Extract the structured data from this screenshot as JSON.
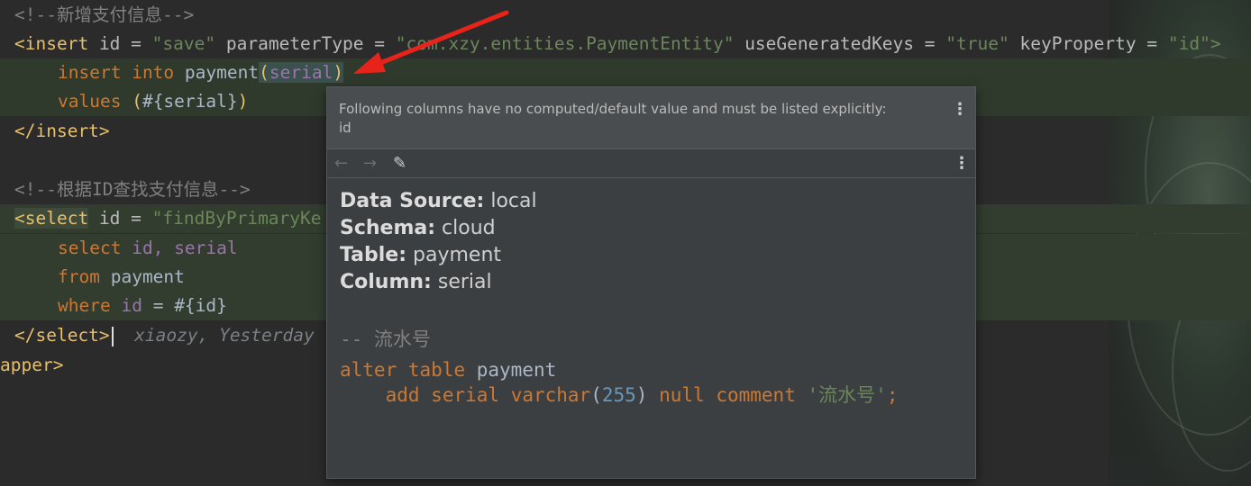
{
  "code": {
    "comment_save": "<!--新增支付信息-->",
    "insert_open": {
      "tag": "<insert",
      "attr1": "id",
      "eq": "=",
      "val1": "\"save\"",
      "attr2": "parameterType",
      "val2": "\"com.xzy.entities.PaymentEntity\"",
      "attr3": "useGeneratedKeys",
      "val3": "\"true\"",
      "attr4": "keyProperty",
      "val4": "\"id\">"
    },
    "insert_line": {
      "kw1": "insert",
      "kw2": "into",
      "table": "payment",
      "open": "(",
      "col": "serial",
      "close": ")"
    },
    "values_line": {
      "kw": "values",
      "open": "(",
      "expr": "#{serial}",
      "close": ")"
    },
    "insert_close": "</insert>",
    "comment_find": "<!--根据ID查找支付信息-->",
    "select_open": {
      "tag": "<select",
      "attr": "id",
      "eq": "=",
      "val": "\"findByPrimaryKe"
    },
    "select_line": {
      "kw": "select",
      "c1": "id,",
      "c2": "serial"
    },
    "from_line": {
      "kw": "from",
      "table": "payment"
    },
    "where_line": {
      "kw": "where",
      "col": "id",
      "eq": "=",
      "expr": "#{id}"
    },
    "select_close": "</select>",
    "inlay_hint": "xiaozy, Yesterday",
    "mapper_close": "apper>"
  },
  "popup": {
    "warning_line1": "Following columns have no computed/default value and must be listed explicitly:",
    "warning_line2": "id",
    "back_icon": "←",
    "forward_icon": "→",
    "edit_icon": "✎",
    "more_icon": "⋮",
    "data_source_label": "Data Source:",
    "data_source": "local",
    "schema_label": "Schema:",
    "schema": "cloud",
    "table_label": "Table:",
    "table": "payment",
    "column_label": "Column:",
    "column": "serial",
    "comment": "-- 流水号",
    "ddl": {
      "alter": "alter",
      "table_kw": "table",
      "table": "payment",
      "add": "add",
      "col": "serial",
      "type": "varchar",
      "open": "(",
      "len": "255",
      "close": ")",
      "null": "null",
      "comment_kw": "comment",
      "comment_val": "'流水号'",
      "semi": ";"
    }
  },
  "colors": {
    "arrow": "#e8231a"
  }
}
